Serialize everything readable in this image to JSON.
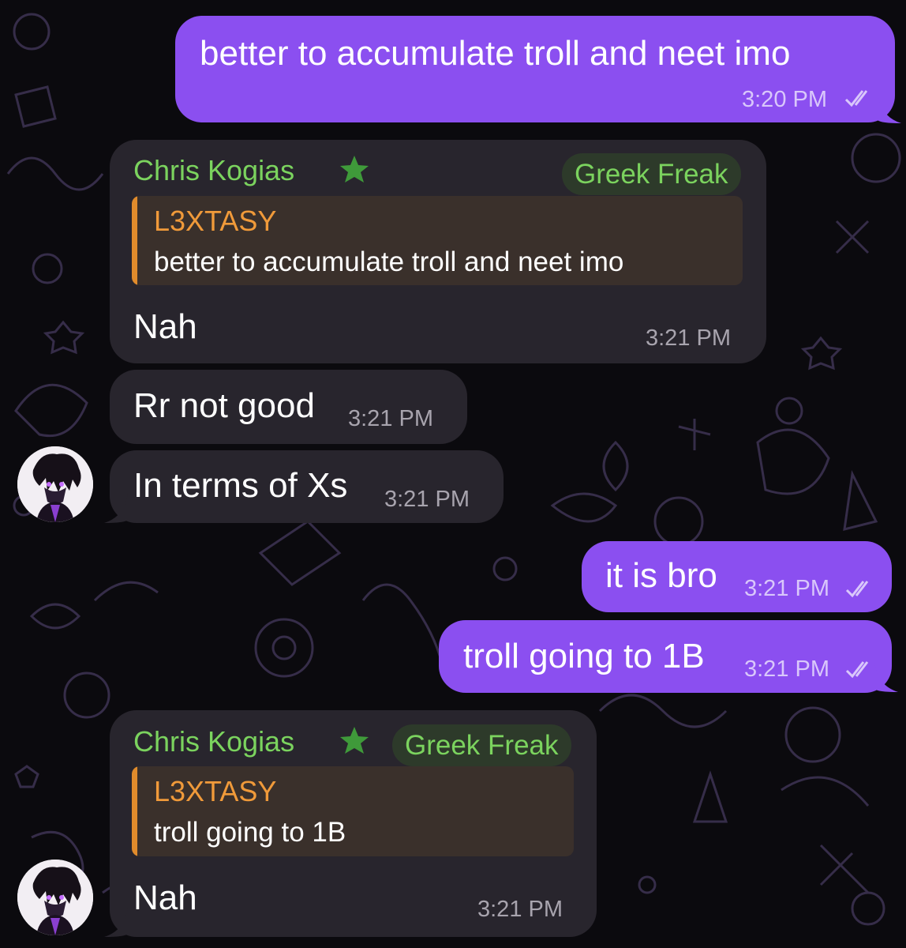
{
  "messages": [
    {
      "id": "m1",
      "dir": "out",
      "text": "better to accumulate troll and neet imo",
      "time": "3:20 PM",
      "read": true
    },
    {
      "id": "m2",
      "dir": "in",
      "sender": "Chris Kogias",
      "badge": "Greek Freak",
      "reply": {
        "name": "L3XTASY",
        "text": "better to accumulate troll and neet imo"
      },
      "text": "Nah",
      "time": "3:21 PM"
    },
    {
      "id": "m3",
      "dir": "in",
      "text": "Rr not good",
      "time": "3:21 PM"
    },
    {
      "id": "m4",
      "dir": "in",
      "text": "In terms of Xs",
      "time": "3:21 PM"
    },
    {
      "id": "m5",
      "dir": "out",
      "text": "it is bro",
      "time": "3:21 PM",
      "read": true
    },
    {
      "id": "m6",
      "dir": "out",
      "text": "troll going to 1B",
      "time": "3:21 PM",
      "read": true
    },
    {
      "id": "m7",
      "dir": "in",
      "sender": "Chris Kogias",
      "badge": "Greek Freak",
      "reply": {
        "name": "L3XTASY",
        "text": "troll going to 1B"
      },
      "text": "Nah",
      "time": "3:21 PM"
    }
  ],
  "colors": {
    "background": "#0b0a0e",
    "outgoing_bubble": "#8b4ff0",
    "incoming_bubble": "#28252d",
    "sender_name": "#7bd35e",
    "reply_accent": "#e08b2c"
  },
  "icons": [
    "double-check-icon",
    "star-icon",
    "avatar"
  ]
}
